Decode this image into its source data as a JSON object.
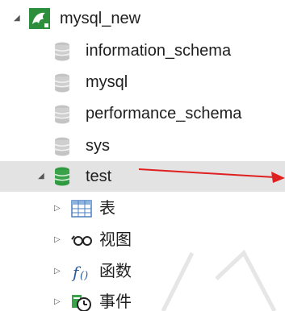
{
  "tree": {
    "connection": {
      "label": "mysql_new",
      "icon": "mysql-dolphin-icon",
      "expanded": true
    },
    "databases": [
      {
        "label": "information_schema",
        "icon": "database-icon",
        "state": "closed"
      },
      {
        "label": "mysql",
        "icon": "database-icon",
        "state": "closed"
      },
      {
        "label": "performance_schema",
        "icon": "database-icon",
        "state": "closed"
      },
      {
        "label": "sys",
        "icon": "database-icon",
        "state": "closed"
      },
      {
        "label": "test",
        "icon": "database-icon",
        "state": "open",
        "selected": true
      }
    ],
    "children": [
      {
        "label": "表",
        "icon": "table-icon"
      },
      {
        "label": "视图",
        "icon": "view-icon"
      },
      {
        "label": "函数",
        "icon": "function-icon"
      },
      {
        "label": "事件",
        "icon": "event-icon"
      }
    ]
  },
  "colors": {
    "selected_row": "#e3e3e3",
    "db_closed": "#bdbdbd",
    "db_open": "#3aa34a",
    "dolphin_bg": "#2d8f3c",
    "annotation_arrow": "#e02020",
    "table_icon": "#4a7fbf"
  }
}
